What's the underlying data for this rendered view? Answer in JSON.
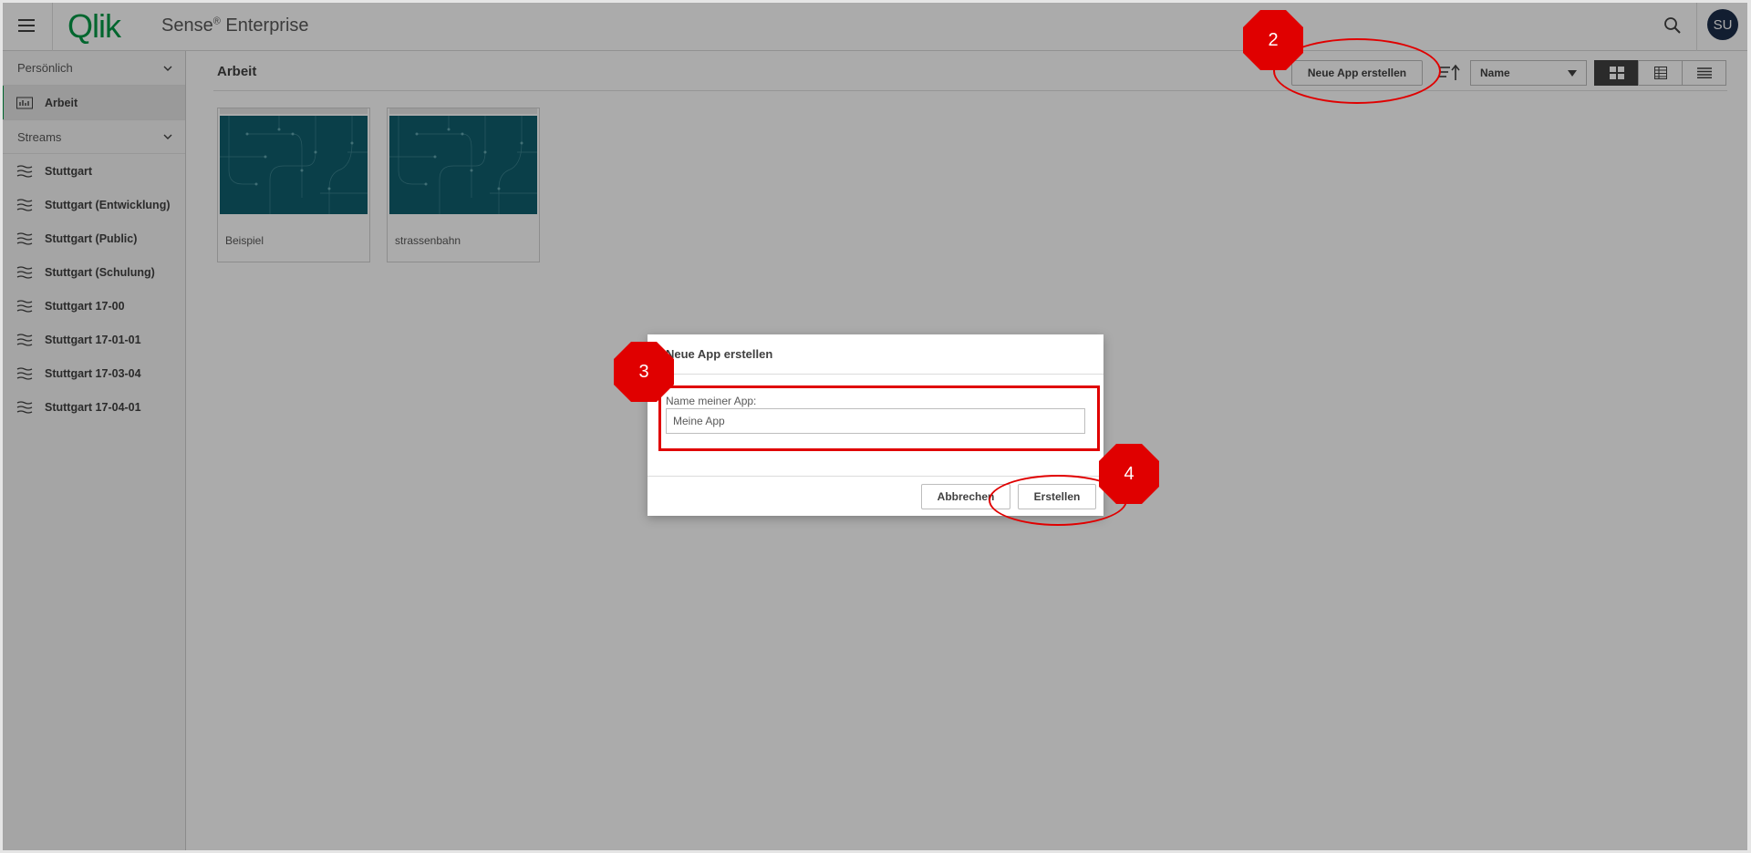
{
  "header": {
    "logo_text": "Qlik",
    "product_name": "Sense",
    "product_reg": "®",
    "product_edition": " Enterprise",
    "avatar_initials": "SU"
  },
  "sidebar": {
    "personal_label": "Persönlich",
    "work_label": "Arbeit",
    "streams_label": "Streams",
    "streams": [
      "Stuttgart",
      "Stuttgart (Entwicklung)",
      "Stuttgart (Public)",
      "Stuttgart (Schulung)",
      "Stuttgart 17-00",
      "Stuttgart 17-01-01",
      "Stuttgart 17-03-04",
      "Stuttgart 17-04-01"
    ]
  },
  "main": {
    "title": "Arbeit",
    "create_app_label": "Neue App erstellen",
    "sort_select_value": "Name",
    "apps": [
      "Beispiel",
      "strassenbahn"
    ]
  },
  "dialog": {
    "title": "Neue App erstellen",
    "field_label": "Name meiner App:",
    "field_value": "Meine App",
    "cancel_label": "Abbrechen",
    "create_label": "Erstellen"
  },
  "annotations": {
    "step_2": "2",
    "step_3": "3",
    "step_4": "4",
    "highlight_color": "#e00000"
  },
  "colors": {
    "brand_green": "#009845",
    "thumbnail_teal": "#0f5f6e",
    "avatar_navy": "#1b2d4a"
  }
}
